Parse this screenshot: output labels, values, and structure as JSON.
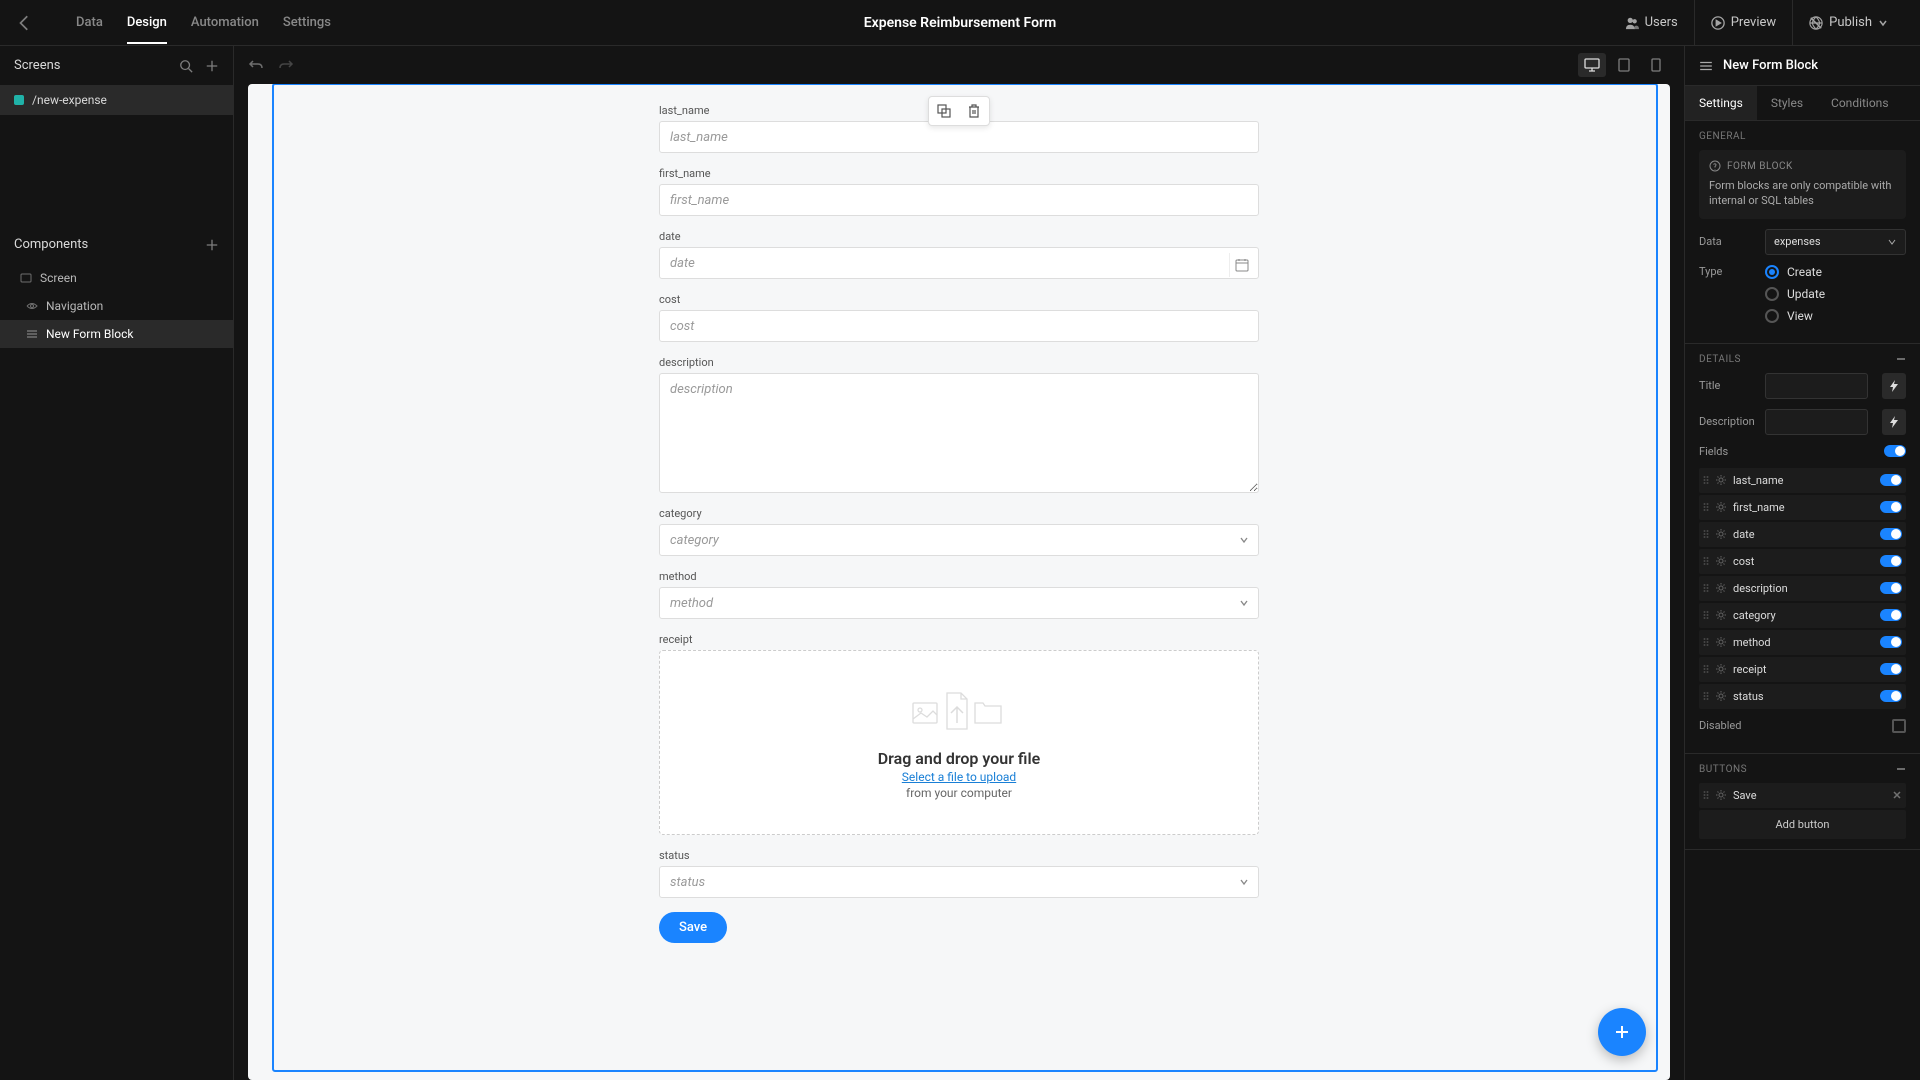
{
  "topnav": {
    "items": [
      "Data",
      "Design",
      "Automation",
      "Settings"
    ],
    "active": 1
  },
  "appTitle": "Expense Reimbursement Form",
  "topActions": {
    "users": "Users",
    "preview": "Preview",
    "publish": "Publish"
  },
  "screens": {
    "title": "Screens",
    "items": [
      {
        "name": "/new-expense"
      }
    ]
  },
  "components": {
    "title": "Components",
    "items": [
      {
        "name": "Screen",
        "icon": "screen"
      },
      {
        "name": "Navigation",
        "icon": "nav"
      },
      {
        "name": "New Form Block",
        "icon": "form",
        "selected": true
      }
    ]
  },
  "form": {
    "fields": {
      "last_name": {
        "label": "last_name",
        "placeholder": "last_name"
      },
      "first_name": {
        "label": "first_name",
        "placeholder": "first_name"
      },
      "date": {
        "label": "date",
        "placeholder": "date"
      },
      "cost": {
        "label": "cost",
        "placeholder": "cost"
      },
      "description": {
        "label": "description",
        "placeholder": "description"
      },
      "category": {
        "label": "category",
        "placeholder": "category"
      },
      "method": {
        "label": "method",
        "placeholder": "method"
      },
      "receipt": {
        "label": "receipt"
      },
      "status": {
        "label": "status",
        "placeholder": "status"
      }
    },
    "dropzone": {
      "title": "Drag and drop your file",
      "link": "Select a file to upload",
      "sub": "from your computer"
    },
    "saveLabel": "Save"
  },
  "inspector": {
    "title": "New Form Block",
    "tabs": [
      "Settings",
      "Styles",
      "Conditions"
    ],
    "activeTab": 0,
    "sections": {
      "general": "GENERAL",
      "details": "DETAILS",
      "buttons": "BUTTONS"
    },
    "infobox": {
      "head": "FORM BLOCK",
      "text": "Form blocks are only compatible with internal or SQL tables"
    },
    "dataLabel": "Data",
    "dataValue": "expenses",
    "typeLabel": "Type",
    "typeOptions": [
      "Create",
      "Update",
      "View"
    ],
    "typeSelected": 0,
    "titleLabel": "Title",
    "descLabel": "Description",
    "fieldsLabel": "Fields",
    "fields": [
      "last_name",
      "first_name",
      "date",
      "cost",
      "description",
      "category",
      "method",
      "receipt",
      "status"
    ],
    "disabledLabel": "Disabled",
    "buttons": [
      "Save"
    ],
    "addButtonLabel": "Add button"
  }
}
